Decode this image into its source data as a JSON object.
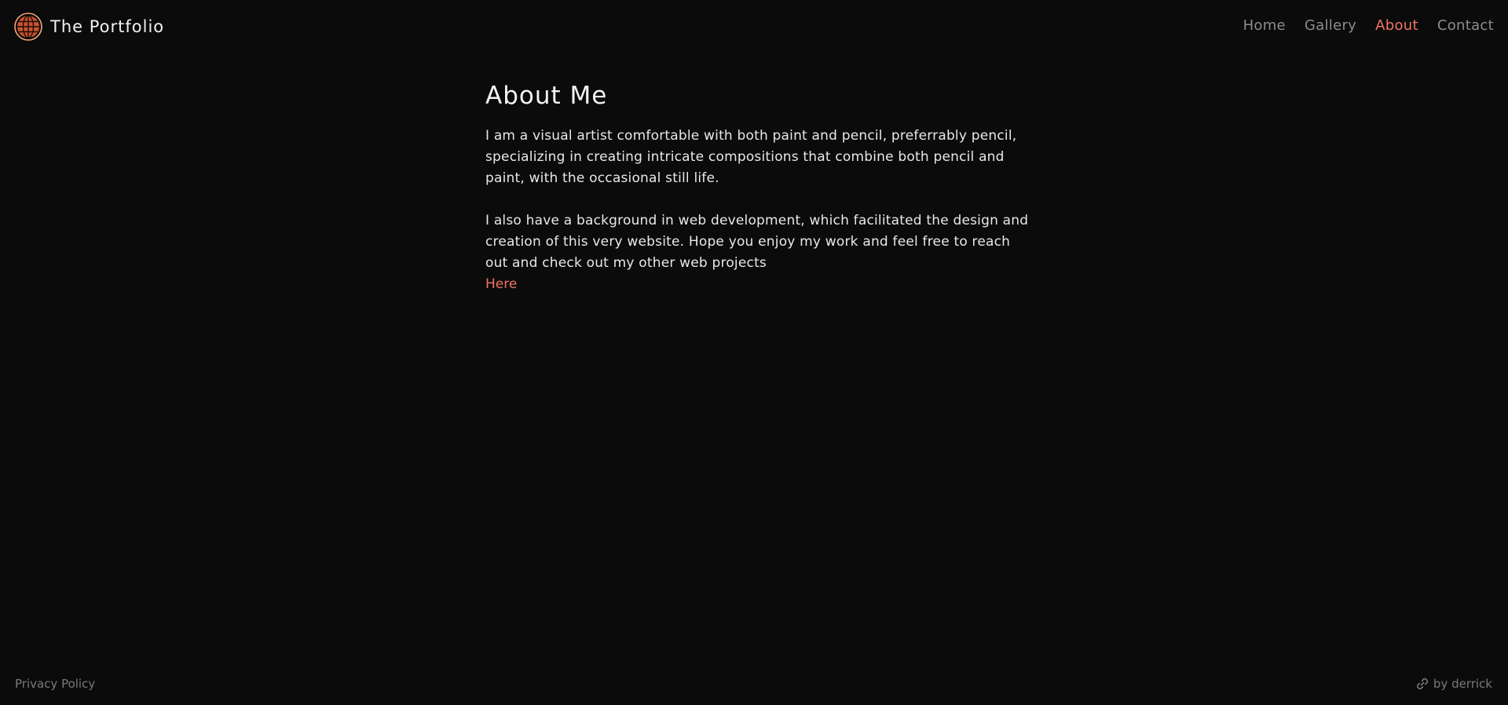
{
  "header": {
    "brand_title": "The Portfolio",
    "brand_icon": "globe-icon",
    "nav": [
      {
        "label": "Home",
        "active": false
      },
      {
        "label": "Gallery",
        "active": false
      },
      {
        "label": "About",
        "active": true
      },
      {
        "label": "Contact",
        "active": false
      }
    ]
  },
  "main": {
    "title": "About Me",
    "paragraphs": [
      "I am a visual artist comfortable with both paint and pencil, preferrably pencil, specializing in creating intricate compositions that combine both pencil and paint, with the occasional still life.",
      "I also have a background in web development, which facilitated the design and creation of this very website. Hope you enjoy my work and feel free to reach out and check out my other web projects"
    ],
    "link_label": "Here"
  },
  "footer": {
    "privacy_label": "Privacy Policy",
    "credit_label": "by derrick",
    "credit_icon": "link-icon"
  },
  "colors": {
    "background": "#0b0b0b",
    "accent": "#f07463",
    "nav_text": "#8c8c8c",
    "body_text": "#e8e8e8"
  }
}
